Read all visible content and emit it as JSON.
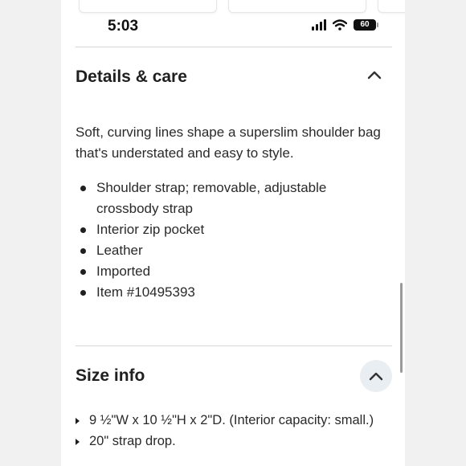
{
  "status_bar": {
    "time": "5:03",
    "battery": "60"
  },
  "details": {
    "title": "Details & care",
    "description": "Soft, curving lines shape a superslim shoulder bag that's understated and easy to style.",
    "bullets": [
      "Shoulder strap; removable, adjustable crossbody strap",
      "Interior zip pocket",
      "Leather",
      "Imported",
      "Item #10495393"
    ]
  },
  "size_info": {
    "title": "Size info",
    "items": [
      "9 ½\"W x 10 ½\"H x 2\"D. (Interior capacity: small.)",
      "20\" strap drop."
    ]
  },
  "icons": {
    "details_toggle": "chevron-up-icon",
    "size_toggle": "chevron-up-icon",
    "signal": "cellular-signal-icon",
    "wifi": "wifi-icon",
    "battery": "battery-icon"
  },
  "colors": {
    "background": "#f1f1f1",
    "surface": "#ffffff",
    "text": "#1f1f1f",
    "toggle_circle": "#e9eef2"
  }
}
